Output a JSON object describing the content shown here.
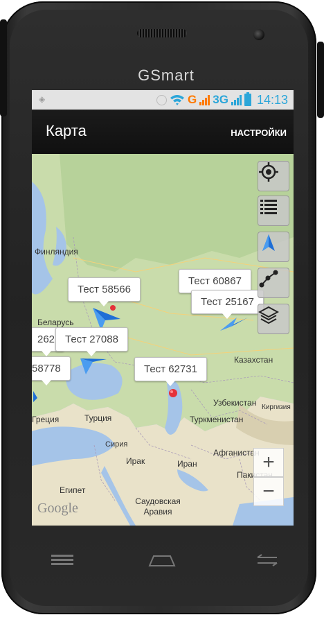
{
  "device": {
    "brand": "GSmart"
  },
  "statusbar": {
    "network_g": "G",
    "network_3g": "3G",
    "time": "14:13"
  },
  "actionbar": {
    "title": "Карта",
    "settings": "НАСТРОЙКИ"
  },
  "map": {
    "labels": {
      "finland": "Финляндия",
      "belarus": "Беларусь",
      "kazakhstan": "Казахстан",
      "uzbekistan": "Узбекистан",
      "kyrgyzstan": "Киргизия",
      "turkmenistan": "Туркменистан",
      "greece": "Греция",
      "turkey": "Турция",
      "syria": "Сирия",
      "iraq": "Ирак",
      "iran": "Иран",
      "afghanistan": "Афганистан",
      "pakistan": "Пакистан",
      "egypt": "Египет",
      "saudi": "Саудовская Аравия"
    },
    "markers": [
      "Тест 58566",
      "Тест 60867",
      "Тест 25167",
      "262",
      "Тест 27088",
      "58778",
      "Тест 62731"
    ],
    "google": "Google",
    "zoom_in": "+",
    "zoom_out": "−"
  },
  "controls": [
    "crosshair-icon",
    "list-icon",
    "navigation-arrow-icon",
    "route-icon",
    "layers-icon"
  ],
  "colors": {
    "accent": "#2ba6d9",
    "network_g": "#ff7a00",
    "actionbar": "#101010",
    "marker": "#e5323a",
    "arrow": "#1f6fd6"
  }
}
